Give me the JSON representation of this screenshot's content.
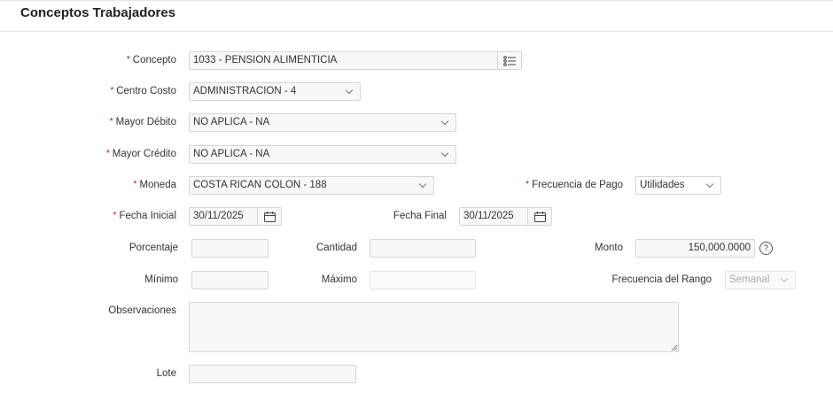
{
  "title": "Conceptos Trabajadores",
  "fields": {
    "concepto": {
      "label": "Concepto",
      "value": "1033 - PENSION ALIMENTICIA",
      "icon": "list-icon"
    },
    "centro_costo": {
      "label": "Centro Costo",
      "value": "ADMINISTRACION - 4"
    },
    "mayor_debito": {
      "label": "Mayor Débito",
      "value": "NO APLICA - NA"
    },
    "mayor_credito": {
      "label": "Mayor Crédito",
      "value": "NO APLICA - NA"
    },
    "moneda": {
      "label": "Moneda",
      "value": "COSTA RICAN COLON - 188"
    },
    "frecuencia_pago": {
      "label": "Frecuencia de Pago",
      "value": "Utilidades"
    },
    "fecha_inicial": {
      "label": "Fecha Inicial",
      "value": "30/11/2025"
    },
    "fecha_final": {
      "label": "Fecha Final",
      "value": "30/11/2025"
    },
    "porcentaje": {
      "label": "Porcentaje",
      "value": ""
    },
    "cantidad": {
      "label": "Cantidad",
      "value": ""
    },
    "monto": {
      "label": "Monto",
      "value": "150,000.0000",
      "help": "?"
    },
    "minimo": {
      "label": "Mínimo",
      "value": ""
    },
    "maximo": {
      "label": "Máximo",
      "value": ""
    },
    "frecuencia_rango": {
      "label": "Frecuencia del Rango",
      "value": "Semanal"
    },
    "observaciones": {
      "label": "Observaciones",
      "value": ""
    },
    "lote": {
      "label": "Lote",
      "value": ""
    }
  },
  "required_mark": "*"
}
